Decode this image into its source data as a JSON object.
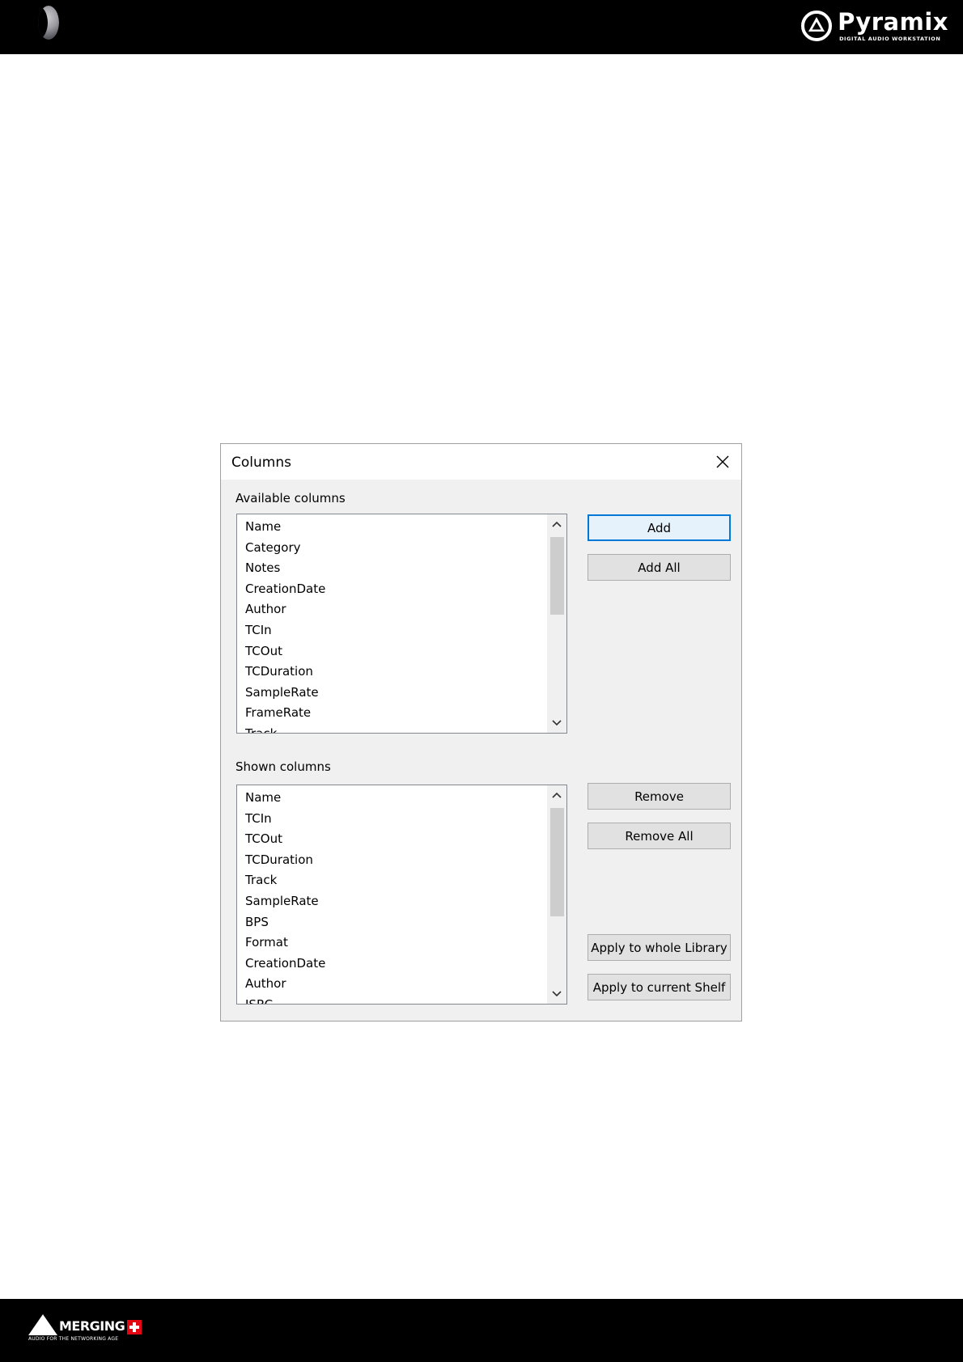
{
  "header": {
    "brand_name": "Pyramix",
    "brand_tagline": "DIGITAL AUDIO WORKSTATION"
  },
  "footer": {
    "brand_name": "MERGING",
    "brand_tagline": "AUDIO FOR THE NETWORKING AGE"
  },
  "dialog": {
    "title": "Columns",
    "close_icon": "close-icon",
    "available": {
      "label": "Available columns",
      "items": [
        "Name",
        "Category",
        "Notes",
        "CreationDate",
        "Author",
        "TCIn",
        "TCOut",
        "TCDuration",
        "SampleRate",
        "FrameRate",
        "Track"
      ]
    },
    "shown": {
      "label": "Shown columns",
      "items": [
        "Name",
        "TCIn",
        "TCOut",
        "TCDuration",
        "Track",
        "SampleRate",
        "BPS",
        "Format",
        "CreationDate",
        "Author",
        "ISRC"
      ]
    },
    "buttons": {
      "add": "Add",
      "add_all": "Add All",
      "remove": "Remove",
      "remove_all": "Remove All",
      "apply_library": "Apply to whole Library",
      "apply_shelf": "Apply to current Shelf"
    }
  }
}
